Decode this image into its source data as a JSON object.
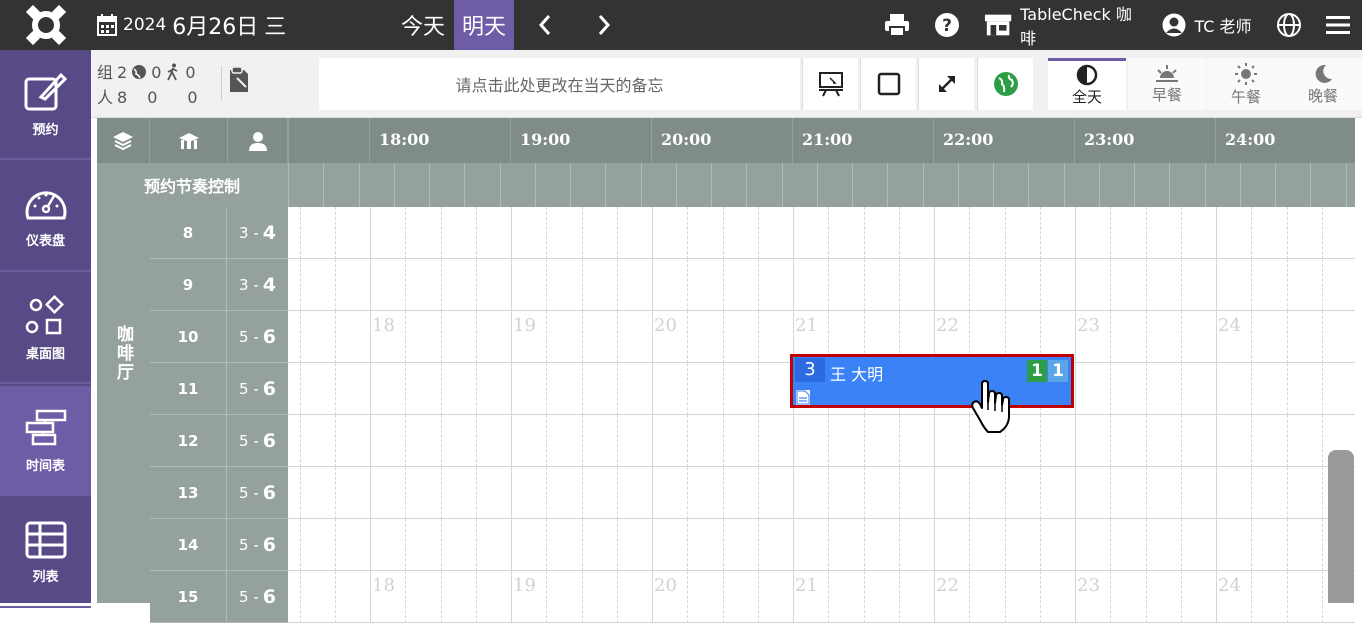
{
  "topbar": {
    "year": "2024",
    "date": "6月26日",
    "weekday": "三",
    "today_label": "今天",
    "tomorrow_label": "明天",
    "store_name": "TableCheck 咖啡",
    "user_name": "TC 老师"
  },
  "sidebar": {
    "items": [
      {
        "label": "预约",
        "icon": "edit-icon"
      },
      {
        "label": "仪表盘",
        "icon": "dashboard-icon"
      },
      {
        "label": "桌面图",
        "icon": "floorplan-icon"
      },
      {
        "label": "时间表",
        "icon": "timetable-icon"
      },
      {
        "label": "列表",
        "icon": "list-icon"
      }
    ],
    "active": "时间表"
  },
  "infobar": {
    "groups_label": "组",
    "groups": "2",
    "online_groups": "0",
    "walkin_groups": "0",
    "people_label": "人",
    "people": "8",
    "online_people": "0",
    "walkin_people": "0",
    "memo_placeholder": "请点击此处更改在当天的备忘"
  },
  "meal_tabs": [
    {
      "label": "全天",
      "icon": "half-circle-icon"
    },
    {
      "label": "早餐",
      "icon": "sunrise-icon"
    },
    {
      "label": "午餐",
      "icon": "sun-icon"
    },
    {
      "label": "晚餐",
      "icon": "moon-icon"
    }
  ],
  "timeline": {
    "hours": [
      "18:00",
      "19:00",
      "20:00",
      "21:00",
      "22:00",
      "23:00",
      "24:00"
    ],
    "ghost_hours": [
      "18",
      "19",
      "20",
      "21",
      "22",
      "23",
      "24"
    ],
    "pace_label": "预约节奏控制",
    "area_label": "咖啡厅"
  },
  "tables": [
    {
      "number": "8",
      "min": "3",
      "max": "4"
    },
    {
      "number": "9",
      "min": "3",
      "max": "4"
    },
    {
      "number": "10",
      "min": "5",
      "max": "6"
    },
    {
      "number": "11",
      "min": "5",
      "max": "6"
    },
    {
      "number": "12",
      "min": "5",
      "max": "6"
    },
    {
      "number": "13",
      "min": "5",
      "max": "6"
    },
    {
      "number": "14",
      "min": "5",
      "max": "6"
    },
    {
      "number": "15",
      "min": "5",
      "max": "6"
    }
  ],
  "reservation": {
    "party_size": "3",
    "guest_name": "王 大明",
    "badge_1": "1",
    "badge_2": "1",
    "table": "11",
    "start": "21:00",
    "end": "23:00"
  },
  "colors": {
    "topbar": "#333333",
    "sidebar": "#574a86",
    "active_purple": "#6e5ca6",
    "grid_header": "#7f8c8a",
    "reservation_blue": "#3b82f6",
    "reservation_border": "#c00000"
  }
}
